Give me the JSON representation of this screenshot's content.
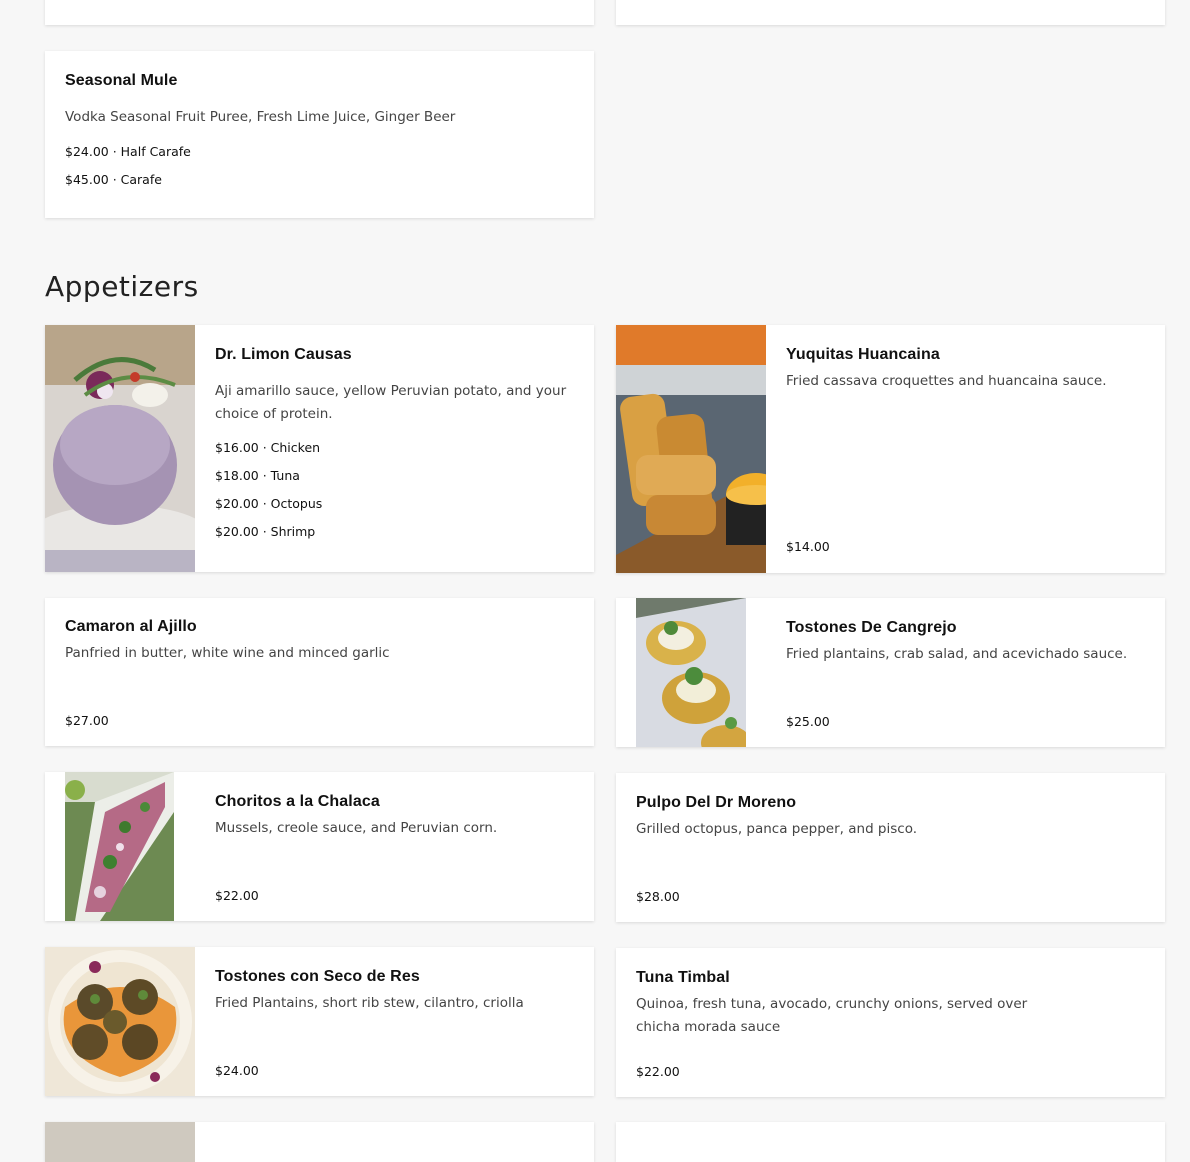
{
  "section": {
    "title": "Appetizers"
  },
  "seasonal_mule": {
    "title": "Seasonal Mule",
    "description": "Vodka Seasonal Fruit Puree, Fresh Lime Juice, Ginger Beer",
    "prices": [
      "$24.00 · Half Carafe",
      "$45.00 · Carafe"
    ]
  },
  "items": {
    "causas": {
      "title": "Dr. Limon Causas",
      "description": "Aji amarillo sauce, yellow Peruvian potato, and your choice of protein.",
      "prices": [
        "$16.00 · Chicken",
        "$18.00 · Tuna",
        "$20.00 · Octopus",
        "$20.00 · Shrimp"
      ],
      "image": "causa-photo"
    },
    "yuquitas": {
      "title": "Yuquitas Huancaina",
      "description": "Fried cassava croquettes and huancaina sauce.",
      "price": "$14.00",
      "image": "yuquitas-photo"
    },
    "camaron": {
      "title": "Camaron al Ajillo",
      "description": "Panfried in butter, white wine and minced garlic",
      "price": "$27.00"
    },
    "tostones_cangrejo": {
      "title": "Tostones De Cangrejo",
      "description": "Fried plantains, crab salad, and acevichado sauce.",
      "price": "$25.00",
      "image": "tostones-cangrejo-photo"
    },
    "choritos": {
      "title": "Choritos a la Chalaca",
      "description": "Mussels, creole sauce, and Peruvian corn.",
      "price": "$22.00",
      "image": "choritos-photo"
    },
    "pulpo": {
      "title": "Pulpo Del Dr Moreno",
      "description": "Grilled octopus, panca pepper, and pisco.",
      "price": "$28.00"
    },
    "tostones_seco": {
      "title": "Tostones con Seco de Res",
      "description": "Fried Plantains, short rib stew, cilantro, criolla",
      "price": "$24.00",
      "image": "tostones-seco-photo"
    },
    "tuna_timbal": {
      "title": "Tuna Timbal",
      "description_line1": "Quinoa, fresh tuna, avocado, crunchy onions, served over",
      "description_line2": "chicha morada sauce",
      "price": "$22.00"
    }
  }
}
